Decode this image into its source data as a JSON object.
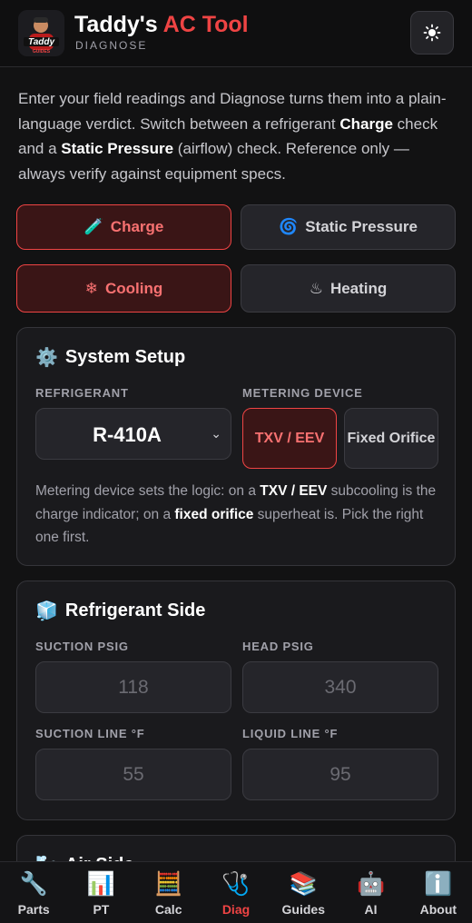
{
  "header": {
    "title_main": "Taddy's ",
    "title_accent": "AC Tool",
    "subtitle": "DIAGNOSE",
    "logo_text": "Taddy",
    "logo_subtext": "GUIDES",
    "theme_icon": "sun-icon"
  },
  "intro": {
    "p1": "Enter your field readings and Diagnose turns them into a plain-language verdict. Switch between a refrigerant ",
    "b1": "Charge",
    "p2": " check and a ",
    "b2": "Static Pressure",
    "p3": " (airflow) check. Reference only — always verify against equipment specs."
  },
  "check_tabs": [
    {
      "icon": "🧪",
      "label": "Charge",
      "active": true
    },
    {
      "icon": "🌀",
      "label": "Static Pressure",
      "active": false
    }
  ],
  "mode_tabs": [
    {
      "icon": "❄",
      "label": "Cooling",
      "active": true
    },
    {
      "icon": "♨",
      "label": "Heating",
      "active": false
    }
  ],
  "system_setup": {
    "icon": "⚙️",
    "title": "System Setup",
    "refrigerant_label": "REFRIGERANT",
    "refrigerant_value": "R-410A",
    "metering_label": "METERING DEVICE",
    "metering_options": [
      "TXV / EEV",
      "Fixed Orifice"
    ],
    "note_p1": "Metering device sets the logic: on a ",
    "note_b1": "TXV / EEV",
    "note_p2": " subcooling is the charge indicator; on a ",
    "note_b2": "fixed orifice",
    "note_p3": " superheat is. Pick the right one first."
  },
  "refrigerant_side": {
    "icon": "🧊",
    "title": "Refrigerant Side",
    "fields": [
      {
        "label": "SUCTION PSIG",
        "placeholder": "118"
      },
      {
        "label": "HEAD PSIG",
        "placeholder": "340"
      },
      {
        "label": "SUCTION LINE °F",
        "placeholder": "55"
      },
      {
        "label": "LIQUID LINE °F",
        "placeholder": "95"
      }
    ]
  },
  "air_side": {
    "icon": "🌬️",
    "title": "Air Side"
  },
  "nav": [
    {
      "icon": "🔧",
      "label": "Parts",
      "active": false
    },
    {
      "icon": "📊",
      "label": "PT",
      "active": false
    },
    {
      "icon": "🧮",
      "label": "Calc",
      "active": false
    },
    {
      "icon": "🩺",
      "label": "Diag",
      "active": true
    },
    {
      "icon": "📚",
      "label": "Guides",
      "active": false
    },
    {
      "icon": "🤖",
      "label": "AI",
      "active": false
    },
    {
      "icon": "ℹ️",
      "label": "About",
      "active": false
    }
  ],
  "colors": {
    "accent": "#ef4444",
    "background": "#121213",
    "card": "#1a1a1d"
  }
}
